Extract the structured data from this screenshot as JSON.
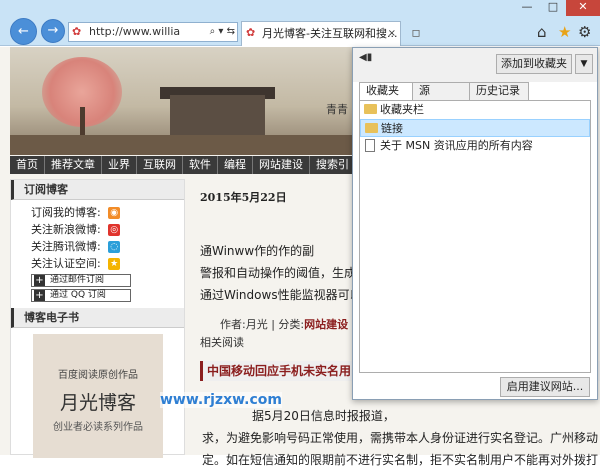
{
  "browser": {
    "window_controls": {
      "minimize": "—",
      "maximize": "□",
      "close": "✕"
    },
    "nav": {
      "back": "←",
      "forward": "→"
    },
    "address": {
      "value": "http://www.willia",
      "tools": "⌕ ▾ ⇆"
    },
    "tab": {
      "title": "月光博客-关注互联网和搜...",
      "close": "×"
    },
    "new_tab": "▫",
    "toolbar": {
      "home": "⌂",
      "favorites": "★",
      "tools": "⚙"
    }
  },
  "site": {
    "banner_text": "青青",
    "nav": [
      "首页",
      "推荐文章",
      "业界",
      "互联网",
      "软件",
      "编程",
      "网站建设",
      "搜索引"
    ],
    "subscribe": {
      "title": "订阅博客",
      "items": [
        {
          "label": "订阅我的博客:",
          "icon": "rss-icon",
          "glyph": "◉"
        },
        {
          "label": "关注新浪微博:",
          "icon": "weibo-icon",
          "glyph": "◎"
        },
        {
          "label": "关注腾讯微博:",
          "icon": "tencent-weibo-icon",
          "glyph": "◌"
        },
        {
          "label": "关注认证空间:",
          "icon": "qzone-icon",
          "glyph": "★"
        }
      ],
      "buttons": [
        "通过邮件订阅",
        "通过 QQ 订阅"
      ]
    },
    "ebook": {
      "title": "博客电子书",
      "subtitle": "百度阅读原创作品",
      "name": "月光博客",
      "tagline": "创业者必读系列作品"
    },
    "article": {
      "date": "2015年5月22日",
      "lines": [
        "通Winww作的作的副",
        "警报和自动操作的阈值，生成",
        "通过Windows性能监视器可以"
      ],
      "meta_prefix": "作者:月光 | 分类:",
      "meta_category": "网站建设",
      "meta_suffix": " | 标",
      "related": "相关阅读",
      "headline": "中国移动回应手机未实名用",
      "body": [
        "据5月20日信息时报报道，",
        "求，为避免影响号码正常使用，需携带本人身份证进行实名登记。广州移动",
        "定。如在短信通知的限期前不进行实名制，拒不实名制用户不能再对外拨打"
      ]
    },
    "watermark": "www.rjzxw.com"
  },
  "favorites_panel": {
    "pin": "◀▮",
    "add_button": "添加到收藏夹",
    "add_arrow": "▼",
    "tabs": [
      "收藏夹",
      "源",
      "历史记录"
    ],
    "items": [
      {
        "label": "收藏夹栏",
        "type": "folder"
      },
      {
        "label": "链接",
        "type": "folder",
        "selected": true
      },
      {
        "label": "关于 MSN 资讯应用的所有内容",
        "type": "page"
      }
    ],
    "sync_button": "启用建议网站..."
  }
}
